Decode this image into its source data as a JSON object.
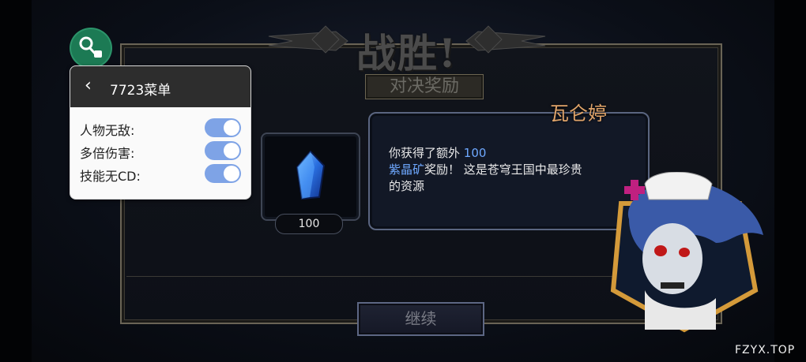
{
  "title": "战胜!",
  "subtitle": "对决奖励",
  "reward": {
    "count": "100",
    "icon": "blue-crystal-icon"
  },
  "dialog": {
    "speaker": "瓦仑婷",
    "line1_prefix": "你获得了额外 ",
    "line1_amount": "100",
    "line2_highlight": "紫晶矿",
    "line2_rest": "奖励！ 这是苍穹王国中最珍贵",
    "line3": "的资源"
  },
  "continue_label": "继续",
  "cheat_menu": {
    "title": "7723菜单",
    "items": [
      {
        "label": "人物无敌:",
        "enabled": true
      },
      {
        "label": "多倍伤害:",
        "enabled": true
      },
      {
        "label": "技能无CD:",
        "enabled": true
      }
    ]
  },
  "watermark": "FZYX.TOP",
  "colors": {
    "highlight": "#6ea8ff",
    "speaker": "#e0a46a",
    "toggle_on": "#7ea3e6",
    "menu_header": "#2d2d2d"
  }
}
